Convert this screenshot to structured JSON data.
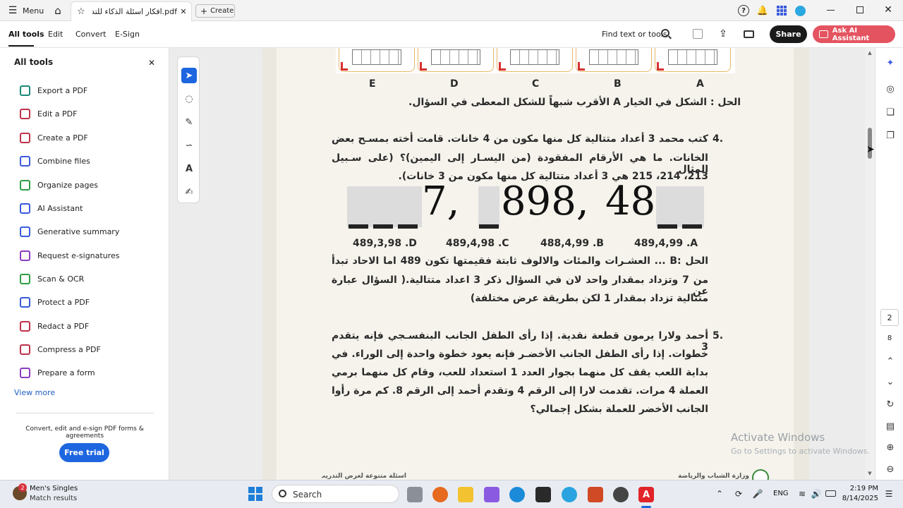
{
  "tabbar": {
    "menu_label": "Menu",
    "tab_title": "pdf.افكار اسئلة الذكاء للتدريب",
    "create_label": "Create"
  },
  "toolbar": {
    "items": [
      "All tools",
      "Edit",
      "Convert",
      "E-Sign"
    ],
    "find_label": "Find text or tools",
    "share_label": "Share",
    "ai_label": "Ask AI Assistant"
  },
  "left_panel": {
    "title": "All tools",
    "tools": [
      {
        "label": "Export a PDF",
        "icon": "export-icon",
        "color": "#1b8a7a"
      },
      {
        "label": "Edit a PDF",
        "icon": "edit-icon",
        "color": "#c0314a"
      },
      {
        "label": "Create a PDF",
        "icon": "create-icon",
        "color": "#c0314a"
      },
      {
        "label": "Combine files",
        "icon": "combine-icon",
        "color": "#3b5bdb"
      },
      {
        "label": "Organize pages",
        "icon": "organize-icon",
        "color": "#2e9e44"
      },
      {
        "label": "AI Assistant",
        "icon": "ai-icon",
        "color": "#3b5bdb"
      },
      {
        "label": "Generative summary",
        "icon": "summary-icon",
        "color": "#3b5bdb"
      },
      {
        "label": "Request e-signatures",
        "icon": "signature-icon",
        "color": "#8a3fc0"
      },
      {
        "label": "Scan & OCR",
        "icon": "scan-icon",
        "color": "#2e9e44"
      },
      {
        "label": "Protect a PDF",
        "icon": "protect-icon",
        "color": "#3b5bdb"
      },
      {
        "label": "Redact a PDF",
        "icon": "redact-icon",
        "color": "#c0314a"
      },
      {
        "label": "Compress a PDF",
        "icon": "compress-icon",
        "color": "#c0314a"
      },
      {
        "label": "Prepare a form",
        "icon": "form-icon",
        "color": "#8a3fc0"
      }
    ],
    "view_more": "View more",
    "promo_text": "Convert, edit and e-sign PDF forms & agreements",
    "free_trial": "Free trial"
  },
  "document": {
    "option_letters": [
      "E",
      "D",
      "C",
      "B",
      "A"
    ],
    "solution_q3": "الحل : الشكل في الخيار A الأقرب شبهاً للشكل المعطى في السؤال.",
    "q4_number": "4.",
    "q4_lines": [
      "كتب محمد 3 أعداد متتالية كل منها مكون من 4 خانات. قامت أخته بمسـح بعض",
      "الخانات. ما هي الأرقام المفقودة (من اليسـار إلى اليمين)؟ (على سـبيل المثال",
      "213، 214، 215 هي 3 أعداد متتالية كل منها مكون من 3 خانات)."
    ],
    "big_digits": [
      "7,",
      "898,",
      "48"
    ],
    "answers": [
      "489,3,98 .D",
      "489,4,98 .C",
      "488,4,99 .B",
      "489,4,99 .A"
    ],
    "solution_q4": [
      "الحل :B ... العشـرات والمئات والالوف ثابتة فقيمتها تكون 489 اما الاحاد تبدأ",
      "من 7 وتزداد بمقدار واحد لان في السؤال ذكر 3 اعداد متتالية.( السؤال عبارة عن",
      "متتالية تزداد بمقدار 1 لكن بطريقة عرض مختلفة)"
    ],
    "q5_number": "5.",
    "q5_lines": [
      "أحمد ولارا يرمون قطعة نقدية. إذا رأى الطفل الجانب البنفسـجي فإنه يتقدم 3",
      "خطوات. إذا رأى الطفل الجانب الأخضـر فإنه يعود خطوة واحدة إلى الوراء. في",
      "بداية اللعب يقف كل منهما بجوار العدد 1 استعداد للعب، وقام كل منهما برمي",
      "العملة 4 مرات. تقدمت لارا إلى الرقم 4 وتقدم أحمد إلى الرقم 8. كم مرة رأوا",
      "الجانب الأخضر للعملة بشكل إجمالي؟"
    ],
    "footer_left": "أسئلة متنوعة لغرض التدريب",
    "footer_right": "وزارة الشباب والرياضة"
  },
  "right_rail": {
    "page_number": "2",
    "page_total": "8"
  },
  "watermark": {
    "line1": "Activate Windows",
    "line2": "Go to Settings to activate Windows."
  },
  "taskbar": {
    "notif_count": "2",
    "news_title": "Men's Singles",
    "news_sub": "Match results",
    "search_placeholder": "Search",
    "lang": "ENG",
    "time": "2:19 PM",
    "date": "8/14/2025"
  }
}
